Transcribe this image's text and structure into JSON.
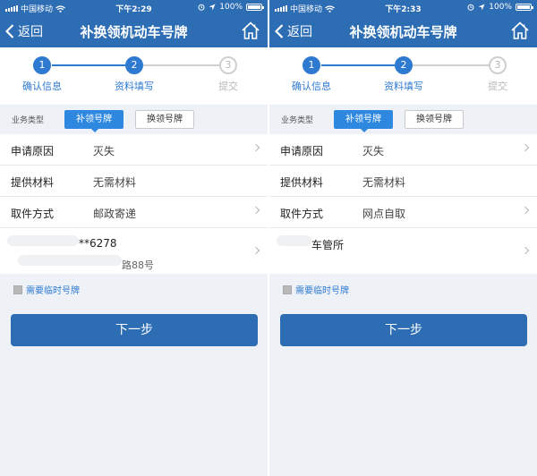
{
  "colors": {
    "primary": "#2c6db4",
    "accent": "#2f88e0",
    "step_active": "#2f7ad1",
    "step_pending": "#cfcfcf"
  },
  "screens": [
    {
      "status": {
        "carrier": "中国移动",
        "time": "下午2:29",
        "battery": "100%",
        "battery_level": 1.0
      },
      "nav": {
        "back_label": "返回",
        "title": "补换领机动车号牌",
        "back_icon": "chevron-left-icon",
        "home_icon": "home-icon"
      },
      "steps": [
        {
          "number": "1",
          "label": "确认信息",
          "state": "done"
        },
        {
          "number": "2",
          "label": "资料填写",
          "state": "current"
        },
        {
          "number": "3",
          "label": "提交",
          "state": "pending"
        }
      ],
      "business": {
        "label": "业务类型",
        "options": [
          "补领号牌",
          "换领号牌"
        ],
        "selected": "补领号牌"
      },
      "fields": [
        {
          "label": "申请原因",
          "value": "灭失"
        },
        {
          "label": "提供材料",
          "value": "无需材料"
        },
        {
          "label": "取件方式",
          "value": "邮政寄递"
        }
      ],
      "delivery": {
        "line1": "**6278",
        "line2": "路88号"
      },
      "temp_plate": {
        "label": "需要临时号牌",
        "checked": false
      },
      "next_button": "下一步"
    },
    {
      "status": {
        "carrier": "中国移动",
        "time": "下午2:33",
        "battery": "100%",
        "battery_level": 1.0
      },
      "nav": {
        "back_label": "返回",
        "title": "补换领机动车号牌",
        "back_icon": "chevron-left-icon",
        "home_icon": "home-icon"
      },
      "steps": [
        {
          "number": "1",
          "label": "确认信息",
          "state": "done"
        },
        {
          "number": "2",
          "label": "资料填写",
          "state": "current"
        },
        {
          "number": "3",
          "label": "提交",
          "state": "pending"
        }
      ],
      "business": {
        "label": "业务类型",
        "options": [
          "补领号牌",
          "换领号牌"
        ],
        "selected": "补领号牌"
      },
      "fields": [
        {
          "label": "申请原因",
          "value": "灭失"
        },
        {
          "label": "提供材料",
          "value": "无需材料"
        },
        {
          "label": "取件方式",
          "value": "网点自取"
        }
      ],
      "delivery": {
        "line1": "车管所",
        "line2": ""
      },
      "temp_plate": {
        "label": "需要临时号牌",
        "checked": false
      },
      "next_button": "下一步"
    }
  ]
}
